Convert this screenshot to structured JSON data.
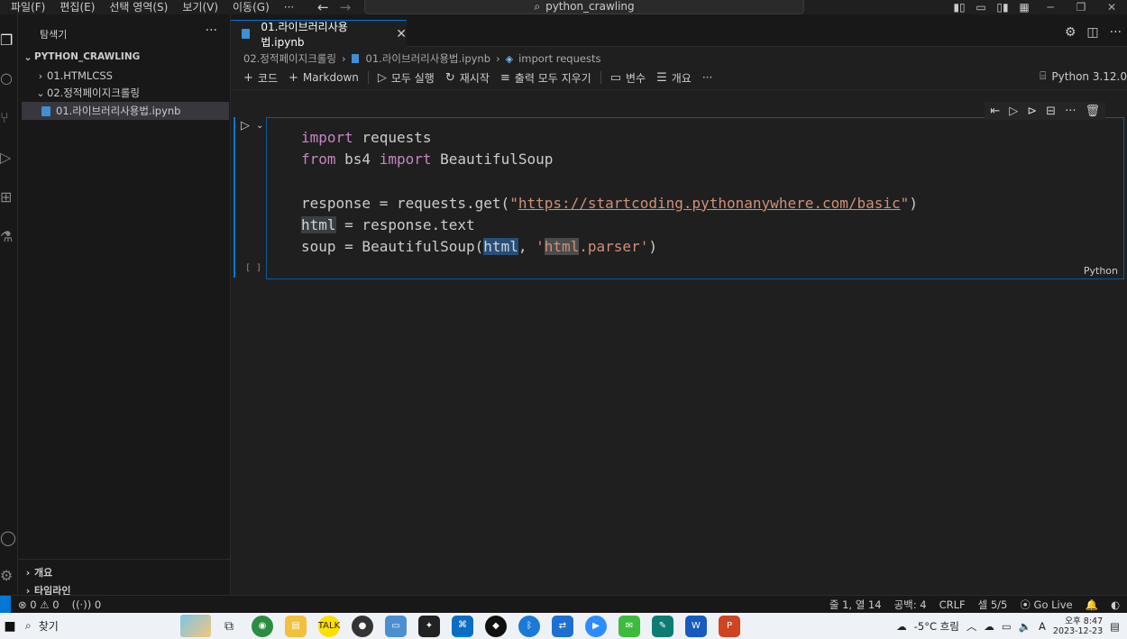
{
  "menu": [
    "파일(F)",
    "편집(E)",
    "선택 영역(S)",
    "보기(V)",
    "이동(G)",
    "···"
  ],
  "command_center": "python_crawling",
  "sidebar": {
    "title": "탐색기",
    "more": "···",
    "root": "PYTHON_CRAWLING",
    "items": [
      {
        "label": "01.HTMLCSS",
        "chevron": "›"
      },
      {
        "label": "02.정적페이지크롤링",
        "chevron": "⌄"
      },
      {
        "label": "01.라이브러리사용법.ipynb"
      }
    ],
    "bottom": [
      {
        "label": "개요"
      },
      {
        "label": "타임라인"
      }
    ]
  },
  "tab": {
    "label": "01.라이브러리사용법.ipynb",
    "close": "✕"
  },
  "breadcrumb": {
    "folder": "02.정적페이지크롤링",
    "file": "01.라이브러리사용법.ipynb",
    "symbol": "import requests"
  },
  "toolbar": {
    "code": "코드",
    "markdown": "Markdown",
    "run_all": "모두 실행",
    "restart": "재시작",
    "clear_outputs": "출력 모두 지우기",
    "variables": "변수",
    "outline": "개요",
    "more": "···",
    "kernel": "Python 3.12.0"
  },
  "cell": {
    "exec_count": "[ ]",
    "language": "Python",
    "code": {
      "l1_kw": "import",
      "l1_rest": " requests",
      "l2_kw1": "from",
      "l2_mid": " bs4 ",
      "l2_kw2": "import",
      "l2_rest": " BeautifulSoup",
      "l4_a": "response = requests.get(",
      "l4_q1": "\"",
      "l4_url": "https://startcoding.pythonanywhere.com/basic",
      "l4_q2": "\"",
      "l4_b": ")",
      "l5_var": "html",
      "l5_rest": " = response.text",
      "l6_a": "soup = BeautifulSoup(",
      "l6_var": "html",
      "l6_b": ", ",
      "l6_q1": "'",
      "l6_hl": "html",
      "l6_s": ".parser'",
      "l6_c": ")"
    }
  },
  "status": {
    "errors": "0",
    "warnings": "0",
    "ports": "0",
    "position": "줄 1, 열 14",
    "spaces": "공백: 4",
    "eol": "CRLF",
    "cell": "셀 5/5",
    "golive": "Go Live"
  },
  "taskbar": {
    "search": "찾기",
    "weather": "-5°C 흐림",
    "time": "오후 8:47",
    "date": "2023-12-23",
    "ime": "A"
  }
}
